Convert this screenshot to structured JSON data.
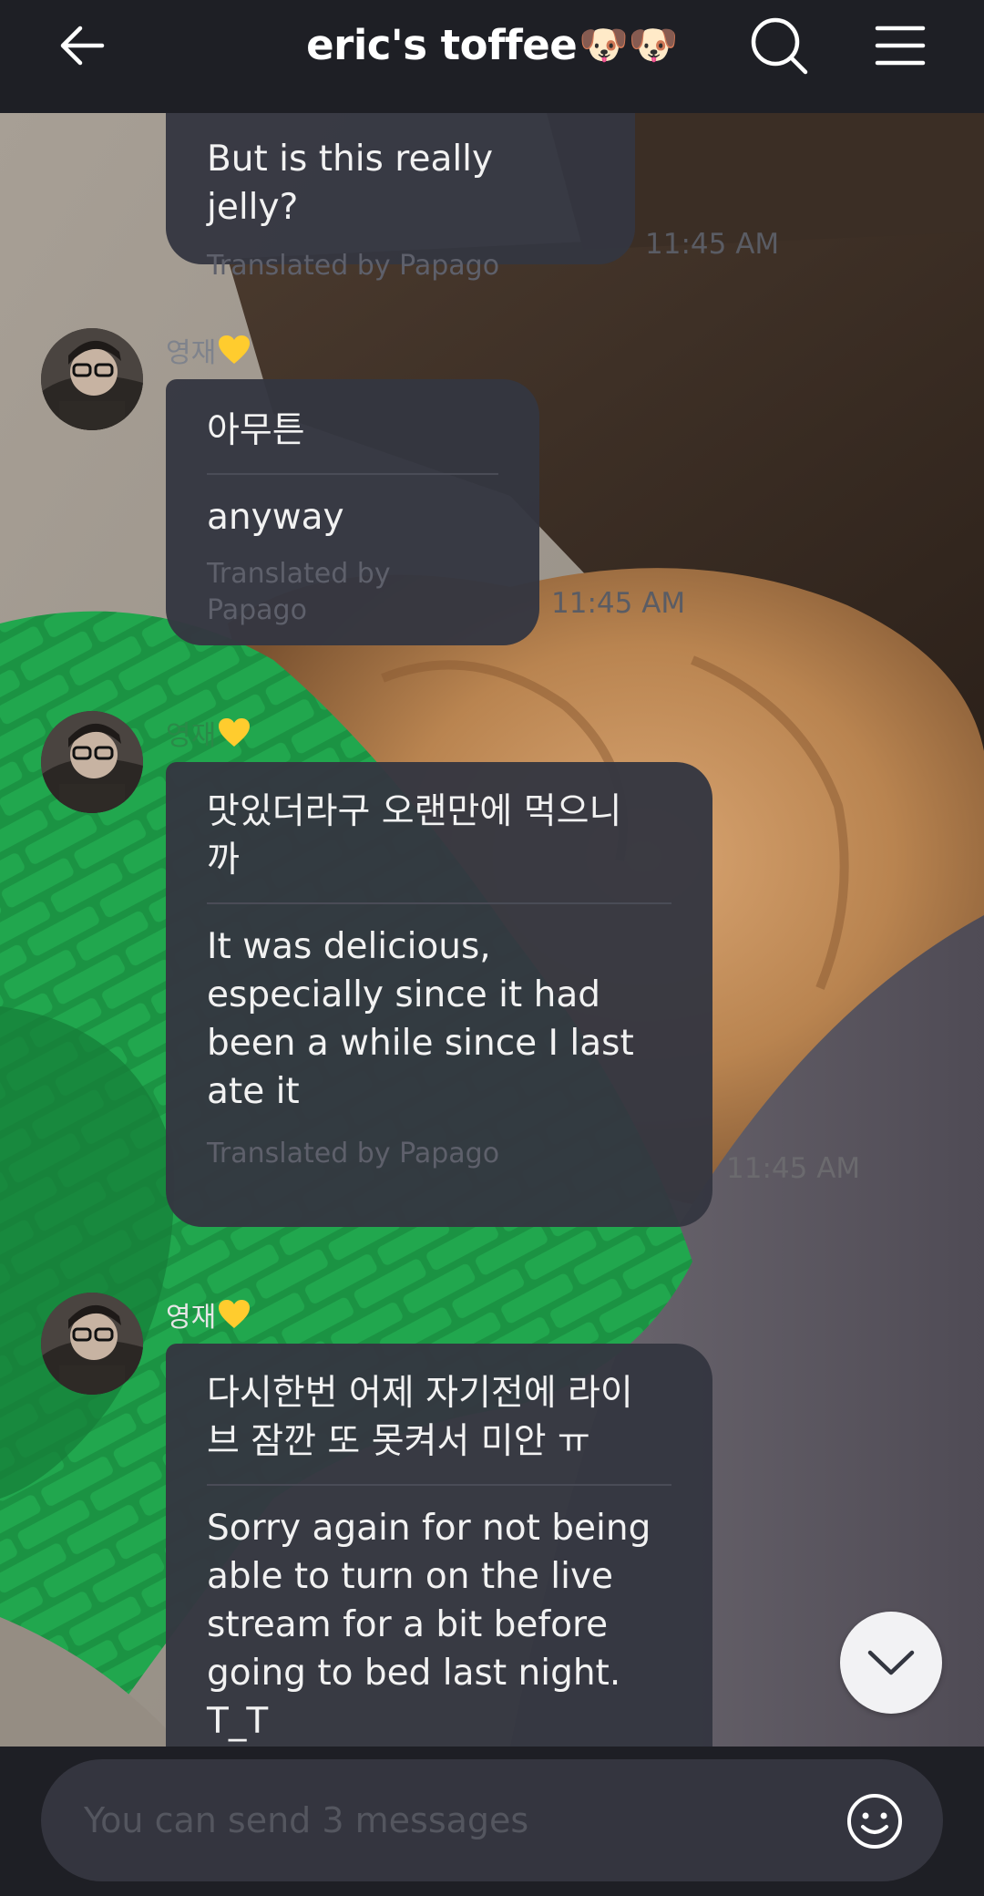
{
  "header": {
    "title": "eric's toffee",
    "title_emoji": "🐶🐶",
    "back_icon": "back-arrow-icon",
    "search_icon": "search-icon",
    "menu_icon": "menu-icon"
  },
  "messages": [
    {
      "sender": "",
      "original": "But is this really jelly?",
      "translation": "",
      "translated_by": "Translated by Papago",
      "time": "11:45 AM"
    },
    {
      "sender": "영재",
      "original": "아무튼",
      "translation": "anyway",
      "translated_by": "Translated by Papago",
      "time": "11:45 AM"
    },
    {
      "sender": "영재",
      "original": "맛있더라구 오랜만에 먹으니\n까",
      "translation": "It was delicious,\nespecially since it had\nbeen a while since I last\nate it",
      "translated_by": "Translated by Papago",
      "time": "11:45 AM"
    },
    {
      "sender": "영재",
      "original": "다시한번 어제 자기전에 라이\n브 잠깐 또 못켜서 미안 ㅠ",
      "translation": "Sorry again for not being\nable to turn on the live\nstream for a bit before\ngoing to bed last night.\nT_T",
      "translated_by": "",
      "time": ""
    }
  ],
  "composer": {
    "placeholder": "You can send 3 messages",
    "emoji_icon": "smiley-icon"
  },
  "scroll_down_icon": "chevron-down-icon",
  "colors": {
    "header_bg": "#1e1f25",
    "bubble_bg": "#343641",
    "composer_bg": "#34353f",
    "heart": "#ffcc2e"
  }
}
